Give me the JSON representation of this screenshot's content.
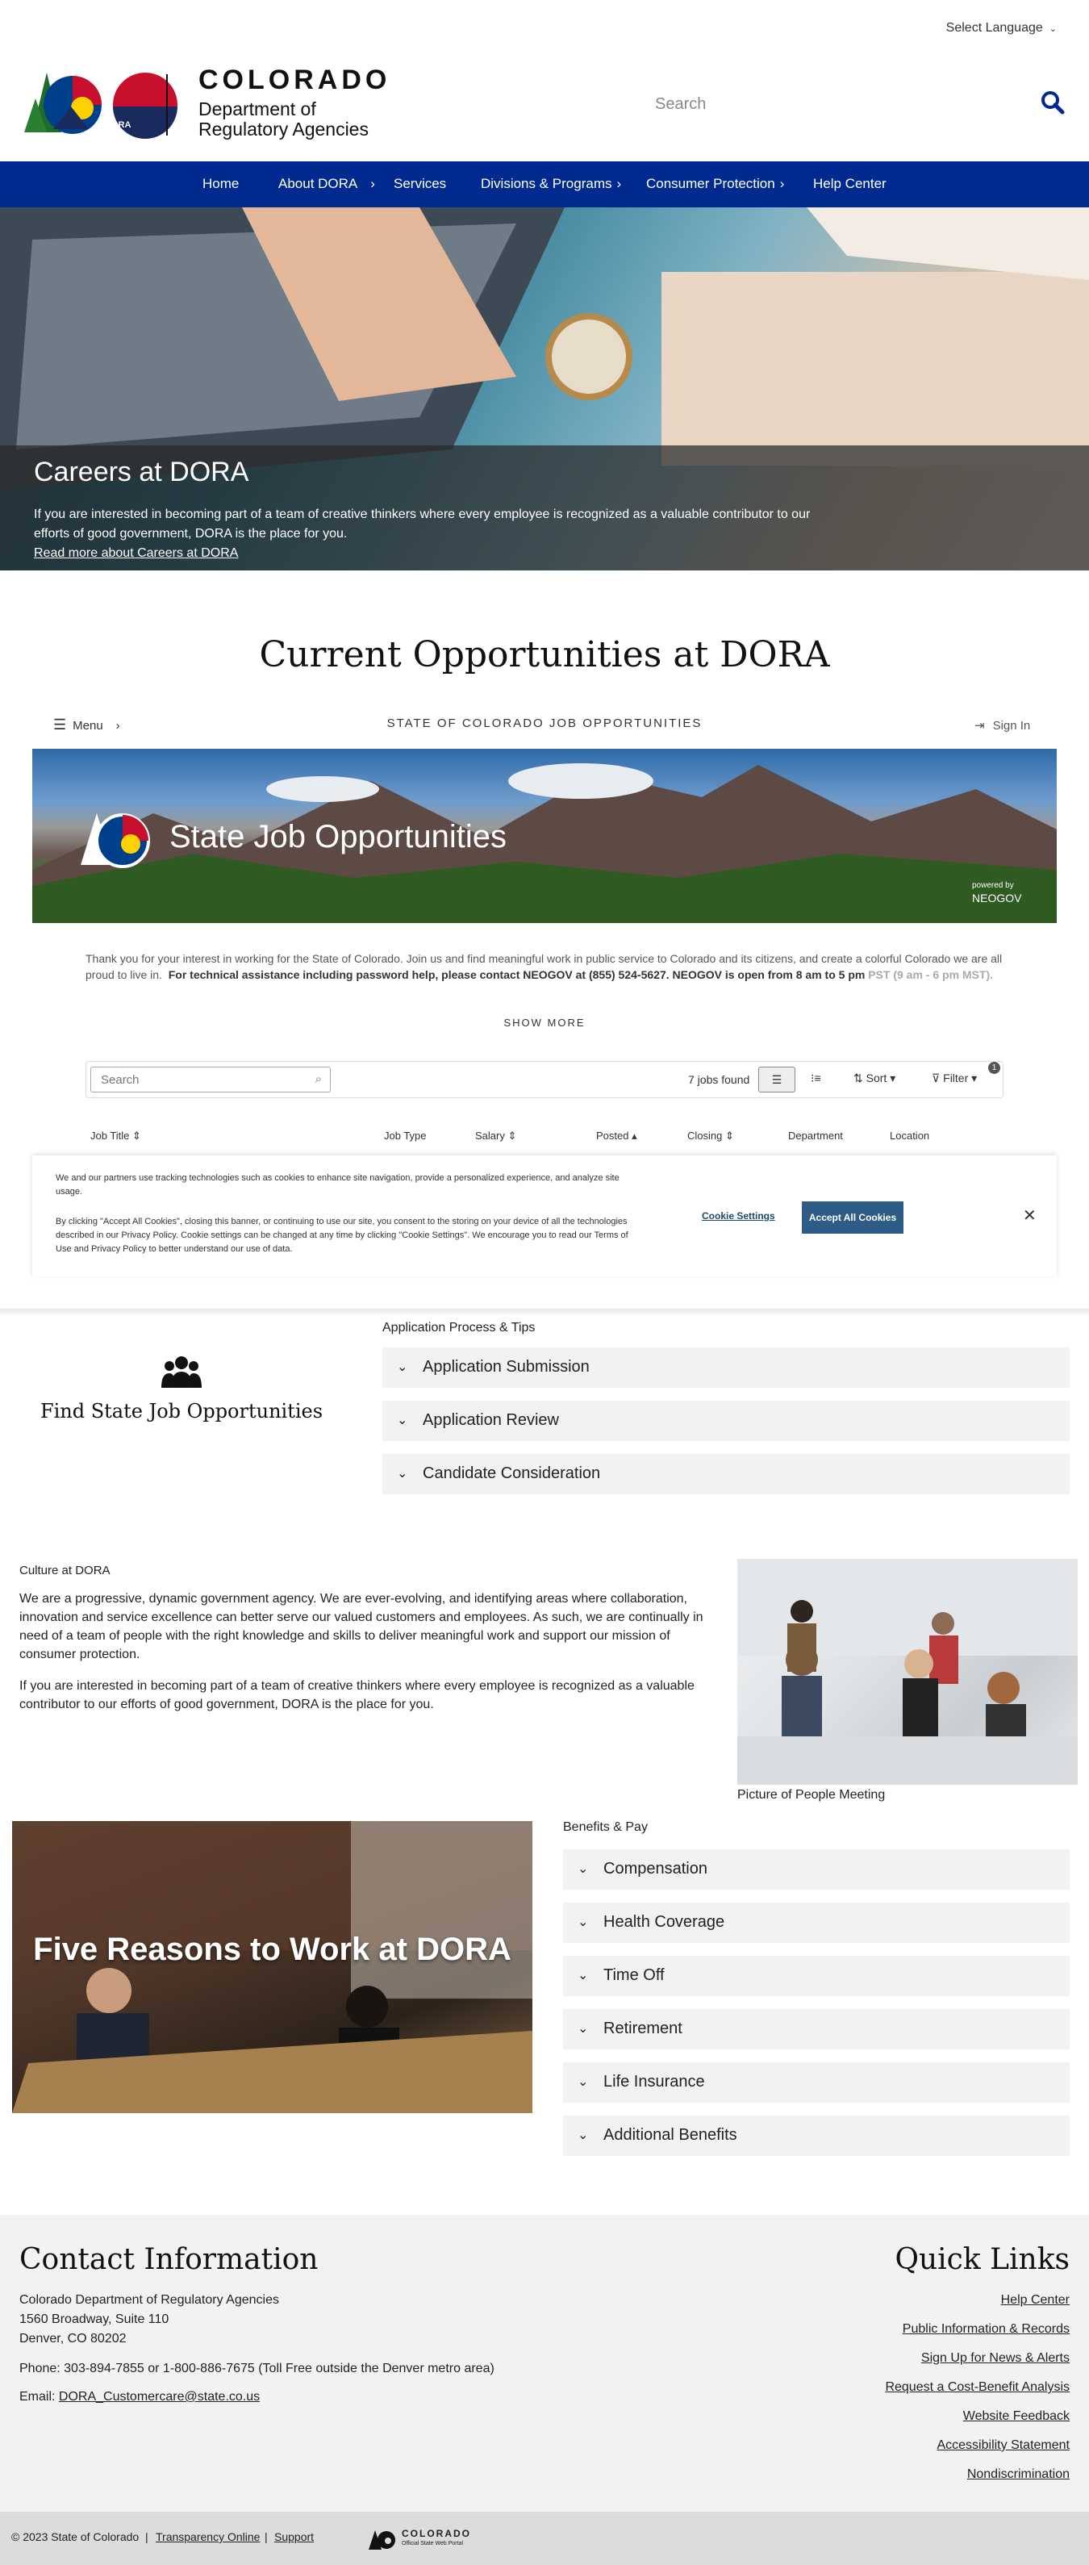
{
  "header": {
    "language_label": "Select Language",
    "logo_name": "COLORADO",
    "logo_sub1": "Department of",
    "logo_sub2": "Regulatory Agencies",
    "logo_badge": "DORA",
    "search_placeholder": "Search"
  },
  "nav": {
    "items": [
      {
        "label": "Home"
      },
      {
        "label": "About DORA"
      },
      {
        "label": "Services"
      },
      {
        "label": "Divisions & Programs"
      },
      {
        "label": "Consumer Protection"
      },
      {
        "label": "Help Center"
      }
    ]
  },
  "hero": {
    "title": "Careers at DORA",
    "text": "If you are interested in becoming part of a team of creative thinkers where every employee is recognized as a valuable contributor to our efforts of good government, DORA is the place for you.",
    "link": "Read more about Careers at DORA"
  },
  "opportunities": {
    "title": "Current Opportunities at DORA",
    "menu_label": "Menu",
    "portal_heading": "STATE OF COLORADO JOB OPPORTUNITIES",
    "signin_label": "Sign In",
    "banner_title": "State Job Opportunities",
    "powered_by": "powered by",
    "neogov": "NEOGOV",
    "intro_text": "Thank you for your interest in working for the State of Colorado. Join us and find meaningful work in public service to Colorado and its citizens, and create a colorful Colorado we are all proud to live in.",
    "intro_bold": "For technical assistance including password help, please contact NEOGOV at (855) 524-5627. NEOGOV is open from 8 am to 5 pm",
    "intro_faded": "PST (9 am - 6 pm MST).",
    "show_more": "SHOW MORE",
    "search_placeholder": "Search",
    "jobs_found": "7 jobs found",
    "sort_label": "Sort",
    "filter_label": "Filter",
    "filter_count": "1",
    "columns": [
      "Job Title",
      "Job Type",
      "Salary",
      "Posted",
      "Closing",
      "Department",
      "Location"
    ]
  },
  "cookie": {
    "p1": "We and our partners use tracking technologies such as cookies to enhance site navigation, provide a personalized experience, and analyze site usage.",
    "p2": "By clicking \"Accept All Cookies\", closing this banner, or continuing to use our site, you consent to the storing on your device of all the technologies described in our Privacy Policy. Cookie settings can be changed at any time by clicking \"Cookie Settings\". We encourage you to read our Terms of Use and Privacy Policy to better understand our use of data.",
    "settings_label": "Cookie Settings",
    "accept_label": "Accept All Cookies",
    "close_label": "✕"
  },
  "find": {
    "title": "Find State Job Opportunities",
    "process_heading": "Application Process & Tips",
    "items": [
      {
        "label": "Application Submission"
      },
      {
        "label": "Application Review"
      },
      {
        "label": "Candidate Consideration"
      }
    ]
  },
  "culture": {
    "heading": "Culture at DORA",
    "p1": "We are a progressive, dynamic government agency. We are ever-evolving, and identifying areas where collaboration, innovation and service excellence can better serve our valued customers and employees.  As such, we are continually in need of a team of people with the right knowledge and skills to deliver meaningful work and support our mission of consumer protection.",
    "p2": "If you are interested in becoming part of a team of creative thinkers where every employee is recognized as a valuable contributor to our efforts of good government, DORA is the place for you.",
    "image_caption": "Picture of People Meeting"
  },
  "reasons": {
    "title": "Five Reasons to Work at DORA"
  },
  "benefits": {
    "heading": "Benefits & Pay",
    "items": [
      {
        "label": "Compensation"
      },
      {
        "label": "Health Coverage"
      },
      {
        "label": "Time Off"
      },
      {
        "label": "Retirement"
      },
      {
        "label": "Life Insurance"
      },
      {
        "label": "Additional Benefits"
      }
    ]
  },
  "footer": {
    "contact_heading": "Contact Information",
    "org": "Colorado Department of Regulatory Agencies",
    "address1": "1560 Broadway, Suite 110",
    "address2": "Denver, CO 80202",
    "phone": "Phone: 303-894-7855 or 1-800-886-7675 (Toll Free outside the Denver metro area)",
    "email_label": "Email:",
    "email": "DORA_Customercare@state.co.us",
    "quick_heading": "Quick Links",
    "links": [
      {
        "label": "Help Center"
      },
      {
        "label": "Public Information & Records"
      },
      {
        "label": "Sign Up for News & Alerts"
      },
      {
        "label": "Request a Cost-Benefit Analysis"
      },
      {
        "label": "Website Feedback"
      },
      {
        "label": "Accessibility Statement"
      },
      {
        "label": "Nondiscrimination"
      }
    ],
    "copyright": "© 2023 State of Colorado",
    "transparency": "Transparency Online",
    "support": "Support",
    "portal_name": "COLORADO",
    "portal_sub": "Official State Web Portal"
  },
  "colors": {
    "nav": "#002a8f",
    "accept": "#2d5d86"
  }
}
